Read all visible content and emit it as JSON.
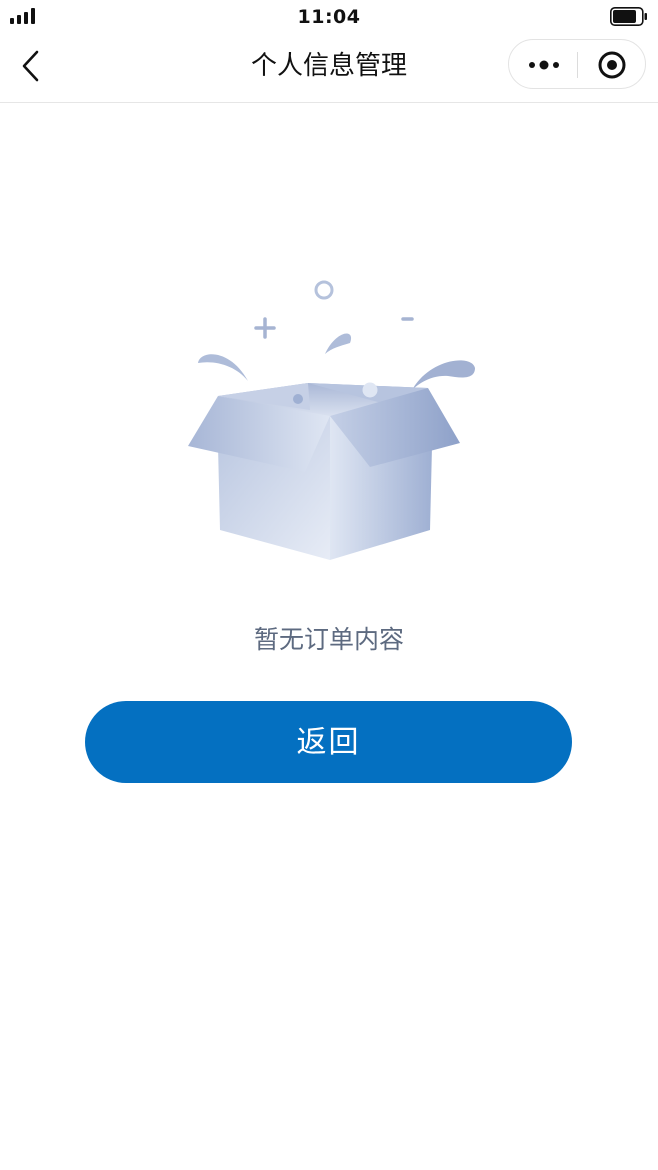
{
  "status_bar": {
    "time": "11:04"
  },
  "nav": {
    "title": "个人信息管理"
  },
  "empty_state": {
    "message": "暂无订单内容"
  },
  "actions": {
    "back_label": "返回"
  },
  "colors": {
    "primary": "#0470c1",
    "muted_text": "#5d6a80",
    "illustration": "#a9b8d6"
  },
  "icons": [
    "back-arrow-icon",
    "more-dots-icon",
    "close-target-icon",
    "signal-icon",
    "battery-icon",
    "empty-box-icon"
  ]
}
